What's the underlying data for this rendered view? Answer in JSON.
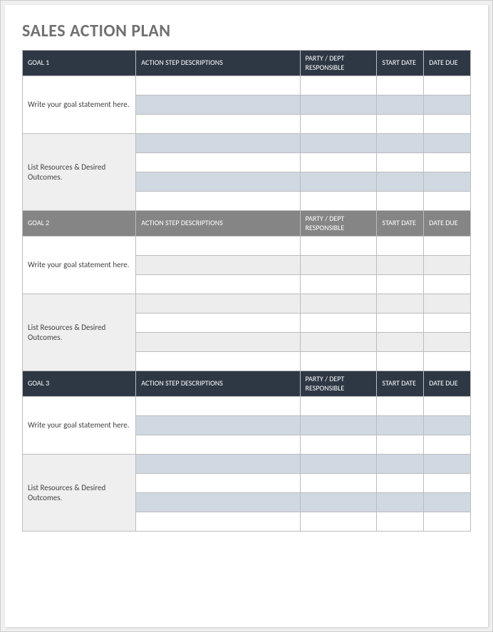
{
  "title": "SALES ACTION PLAN",
  "columns": {
    "action": "ACTION STEP DESCRIPTIONS",
    "party": "PARTY / DEPT RESPONSIBLE",
    "start": "START DATE",
    "due": "DATE DUE"
  },
  "goals": [
    {
      "label": "GOAL 1",
      "goal_text": "Write your goal statement here.",
      "resources_text": "List Resources & Desired Outcomes.",
      "header_style": "dark",
      "alt_style": "blue"
    },
    {
      "label": "GOAL 2",
      "goal_text": "Write your goal statement here.",
      "resources_text": "List Resources & Desired Outcomes.",
      "header_style": "grey",
      "alt_style": "grey"
    },
    {
      "label": "GOAL 3",
      "goal_text": "Write your goal statement here.",
      "resources_text": "List Resources & Desired Outcomes.",
      "header_style": "dark",
      "alt_style": "blue"
    }
  ]
}
